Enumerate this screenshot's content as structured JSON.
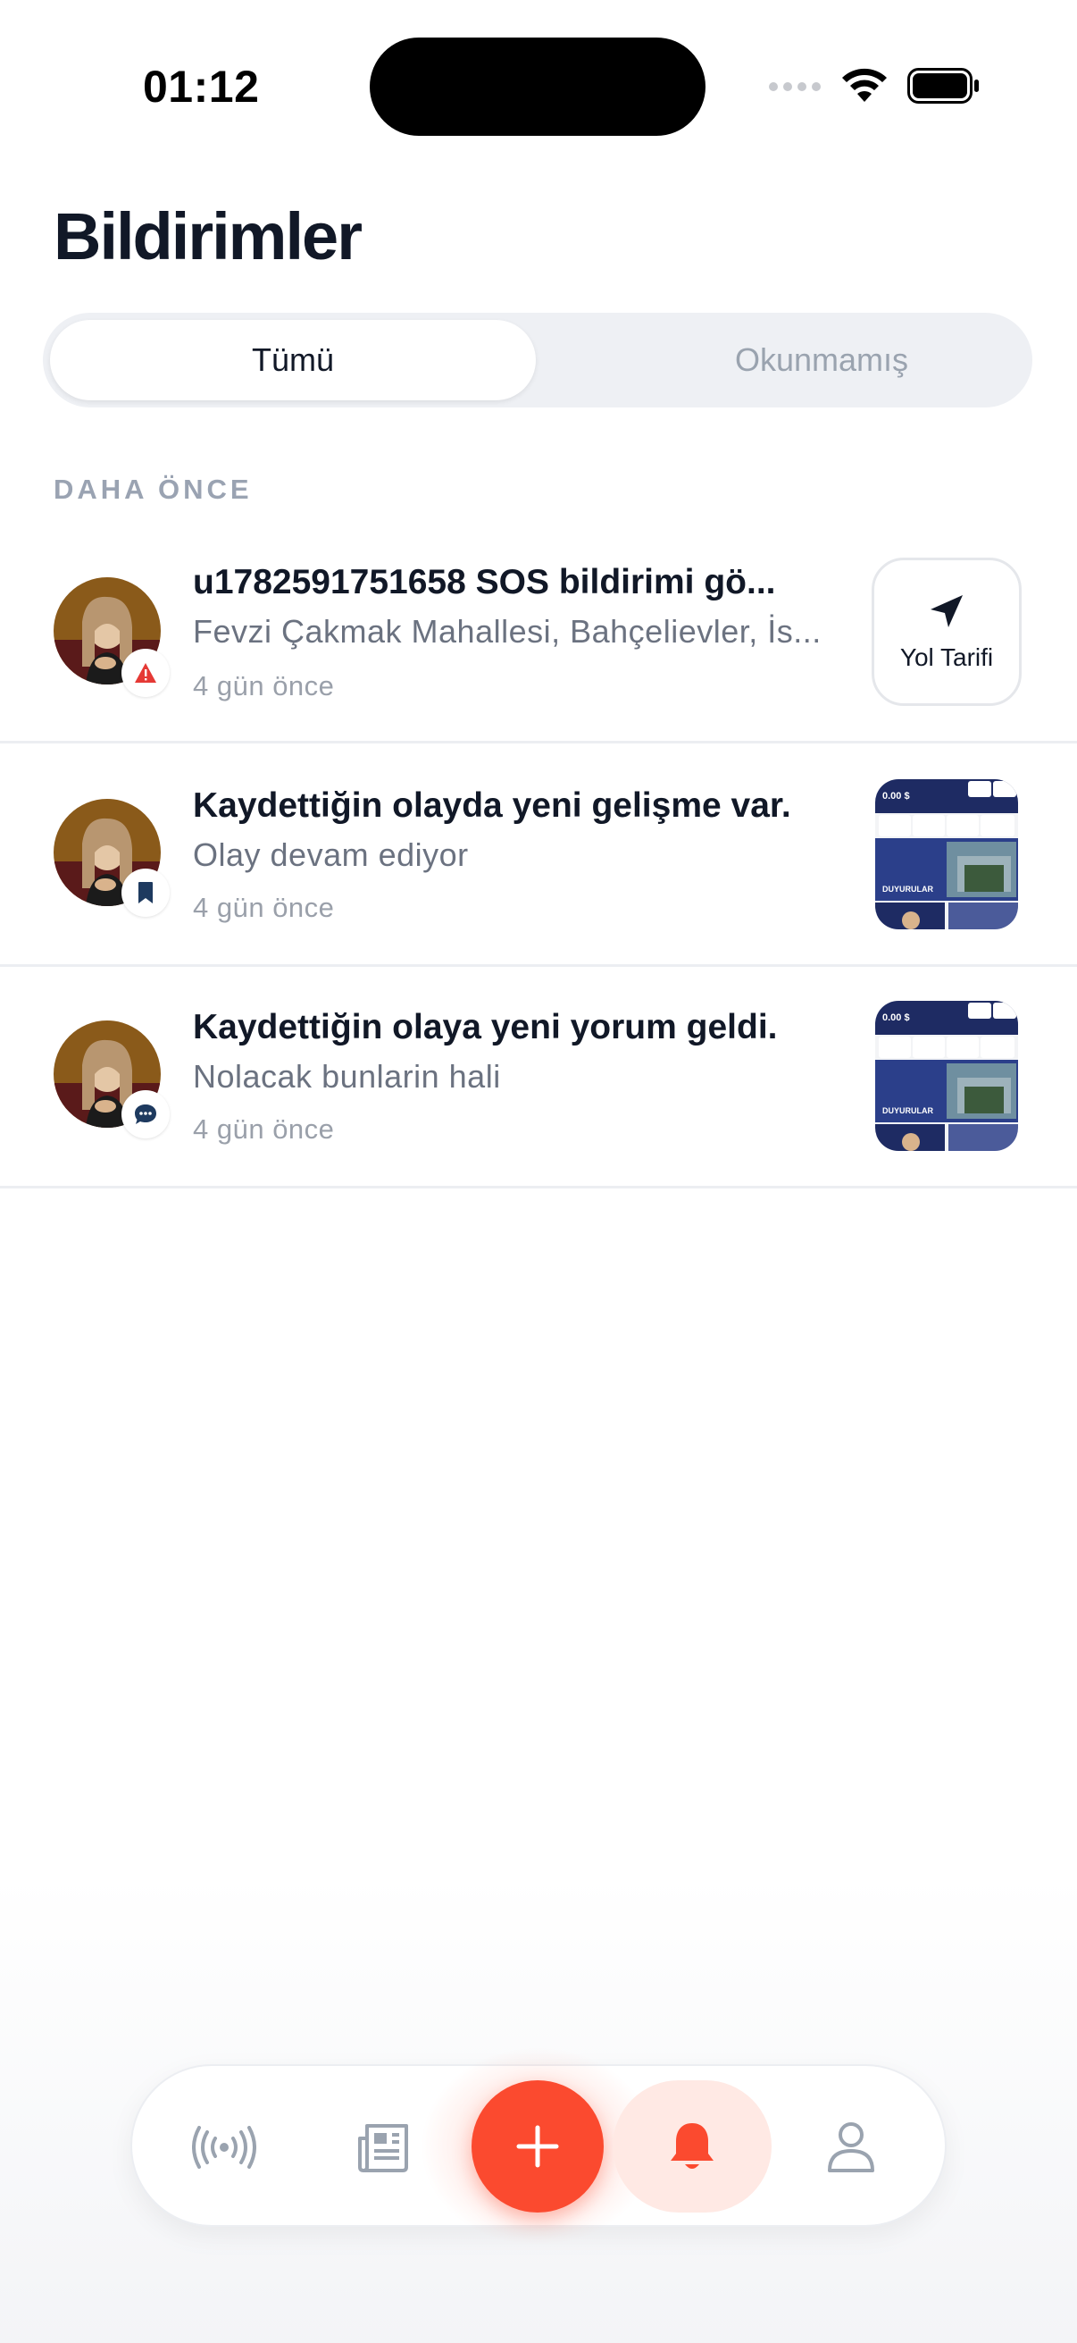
{
  "status_bar": {
    "time": "01:12"
  },
  "header": {
    "title": "Bildirimler"
  },
  "filter": {
    "tabs": [
      {
        "label": "Tümü",
        "selected": true
      },
      {
        "label": "Okunmamış",
        "selected": false
      }
    ]
  },
  "section": {
    "label": "DAHA ÖNCE"
  },
  "notifications": [
    {
      "title": "u1782591751658 SOS bildirimi gö...",
      "body": "Fevzi Çakmak Mahallesi, Bahçelievler, İs...",
      "time": "4 gün önce",
      "badge_icon": "warning-icon",
      "badge_color": "#e53935",
      "action": {
        "label": "Yol Tarifi",
        "icon": "navigation-arrow-icon"
      }
    },
    {
      "title": "Kaydettiğin olayda yeni gelişme var.",
      "body": "Olay devam ediyor",
      "time": "4 gün önce",
      "badge_icon": "bookmark-icon",
      "badge_color": "#1e3a5f",
      "thumbnail": {
        "price": "0.00 $",
        "caption": "DUYURULAR"
      }
    },
    {
      "title": "Kaydettiğin olaya yeni yorum geldi.",
      "body": "Nolacak bunlarin hali",
      "time": "4 gün önce",
      "badge_icon": "comment-icon",
      "badge_color": "#1e3a5f",
      "thumbnail": {
        "price": "0.00 $",
        "caption": "DUYURULAR"
      }
    }
  ],
  "tab_bar": {
    "items": [
      {
        "name": "live",
        "icon": "broadcast-icon",
        "active": false
      },
      {
        "name": "news",
        "icon": "newspaper-icon",
        "active": false
      },
      {
        "name": "add",
        "icon": "plus-icon",
        "active": false
      },
      {
        "name": "notifications",
        "icon": "bell-icon",
        "active": true
      },
      {
        "name": "profile",
        "icon": "user-icon",
        "active": false
      }
    ],
    "accent_color": "#fb4a2f",
    "inactive_color": "#9aa3af"
  }
}
